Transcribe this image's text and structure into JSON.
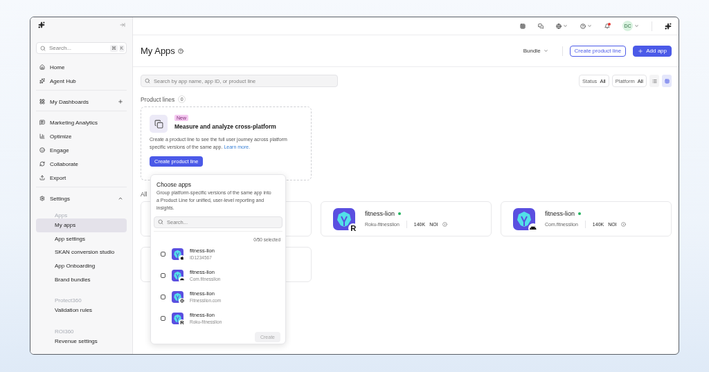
{
  "sidebar": {
    "search": {
      "placeholder": "Search...",
      "keys": [
        "⌘",
        "K"
      ]
    },
    "groups": [
      {
        "items": [
          {
            "label": "Home",
            "kind": "link",
            "selected": false
          },
          {
            "label": "Agent Hub",
            "kind": "link",
            "selected": false
          }
        ]
      },
      {
        "items": [
          {
            "label": "My Dashboards",
            "kind": "addable",
            "selected": false
          }
        ]
      },
      {
        "items": [
          {
            "label": "Marketing Analytics",
            "kind": "link",
            "selected": false
          },
          {
            "label": "Optimize",
            "kind": "link",
            "selected": false
          },
          {
            "label": "Engage",
            "kind": "link",
            "selected": false
          },
          {
            "label": "Collaborate",
            "kind": "link",
            "selected": false
          },
          {
            "label": "Export",
            "kind": "link",
            "selected": false
          }
        ]
      },
      {
        "items": [
          {
            "label": "Settings",
            "kind": "expandable",
            "expanded": true,
            "selected": false,
            "children": [
              {
                "kind": "heading",
                "label": "Apps"
              },
              {
                "kind": "link",
                "label": "My apps",
                "selected": true
              },
              {
                "kind": "link",
                "label": "App settings",
                "selected": false
              },
              {
                "kind": "link",
                "label": "SKAN conversion studio",
                "selected": false
              },
              {
                "kind": "link",
                "label": "App Onboarding",
                "selected": false
              },
              {
                "kind": "link",
                "label": "Brand bundles",
                "selected": false
              },
              {
                "kind": "heading",
                "label": "Protect360"
              },
              {
                "kind": "link",
                "label": "Validation rules",
                "selected": false
              },
              {
                "kind": "heading",
                "label": "ROI360"
              },
              {
                "kind": "link",
                "label": "Revenue settings",
                "selected": false
              }
            ]
          }
        ]
      }
    ]
  },
  "topbar": {
    "avatar": "DC",
    "notification": true
  },
  "page": {
    "title": "My Apps",
    "bundle": "Bundle",
    "buttons": [
      {
        "label": "Create product line",
        "kind": "outline"
      },
      {
        "label": "Add app",
        "kind": "primary"
      }
    ]
  },
  "filters": {
    "search": {
      "placeholder": "Search by app name, app ID, or product line"
    },
    "chips": [
      {
        "label": "Status",
        "value": "All"
      },
      {
        "label": "Platform",
        "value": "All"
      }
    ],
    "view_modes": [
      {
        "selected": false
      },
      {
        "selected": true
      }
    ]
  },
  "product_lines": {
    "title": "Product lines",
    "count": "0",
    "badge": "New",
    "heading": "Measure and analyze cross-platform",
    "description": "Create a product line to see the full user journey across platform specific versions of the same app.",
    "link": "Learn more.",
    "button": "Create product line"
  },
  "apps_heading": "All",
  "apps": [
    {
      "kind": "covered"
    },
    {
      "kind": "roku",
      "name": "fitness-lion",
      "color": "#22b35e",
      "badge": "R",
      "id": "Roku-fitnesslion",
      "count": "140K",
      "metric": "NOI"
    },
    {
      "kind": "android",
      "name": "fitness-lion",
      "color": "#22b35e",
      "id": "Com.fitnesslion",
      "count": "140K",
      "metric": "NOI"
    },
    {
      "kind": "covered"
    }
  ],
  "popover": {
    "title": "Choose apps",
    "description": "Group platform-specific versions of the same app into a Product Line for unified, user-level reporting and insights.",
    "search": {
      "placeholder": "Search..."
    },
    "counter": "0/50 selected",
    "items": [
      {
        "name": "fitness-lion",
        "id": "ID1234567",
        "kind": "apple",
        "checked": false
      },
      {
        "name": "fitness-lion",
        "id": "Com.fitnesslion",
        "kind": "android",
        "checked": false
      },
      {
        "name": "fitness-lion",
        "id": "Fitnesslion.com",
        "kind": "web",
        "checked": false
      },
      {
        "name": "fitness-lion",
        "id": "Roku-fitnesslion",
        "kind": "roku",
        "badge": "R",
        "checked": false
      }
    ],
    "button": {
      "label": "Create",
      "disabled": true
    }
  }
}
